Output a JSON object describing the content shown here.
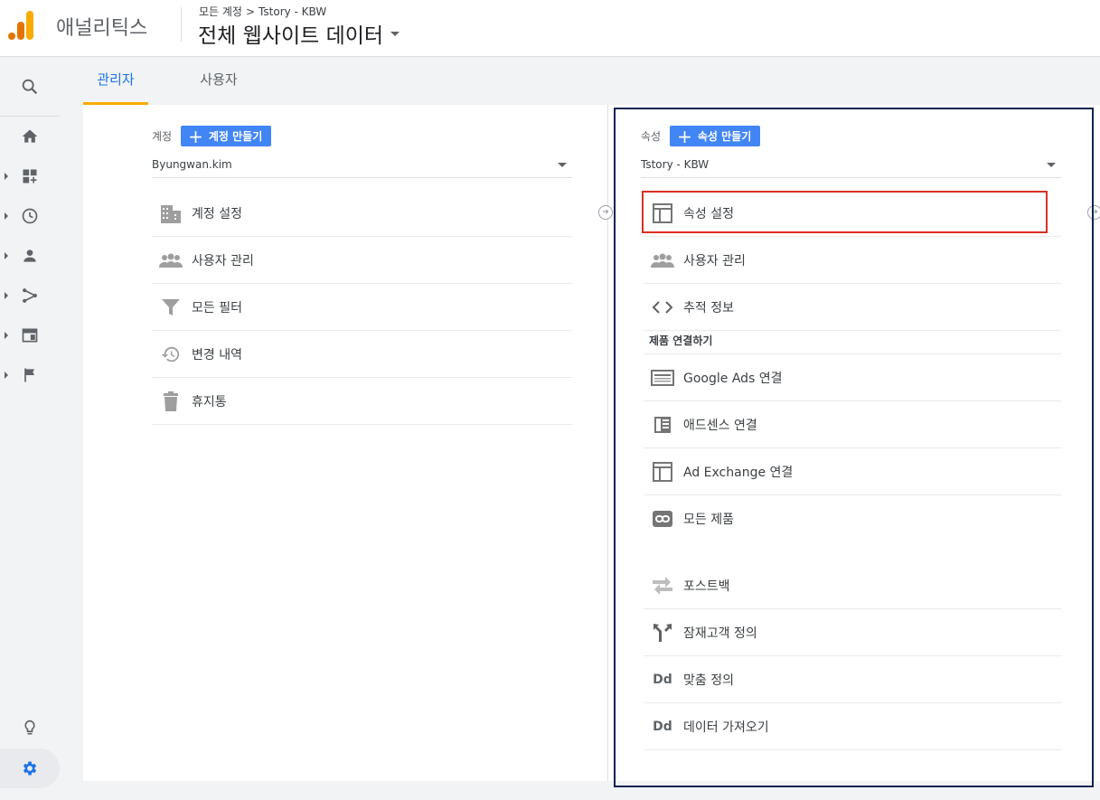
{
  "header": {
    "app_name": "애널리틱스",
    "breadcrumb": [
      "모든 계정",
      "Tstory - KBW"
    ],
    "breadcrumb_separator": ">",
    "view_title": "전체 웹사이트 데이터"
  },
  "tabs": [
    {
      "label": "관리자",
      "active": true
    },
    {
      "label": "사용자",
      "active": false
    }
  ],
  "account_column": {
    "label": "계정",
    "create_button": "계정 만들기",
    "selected": "Byungwan.kim",
    "items": [
      {
        "label": "계정 설정",
        "icon": "building-icon"
      },
      {
        "label": "사용자 관리",
        "icon": "people-icon"
      },
      {
        "label": "모든 필터",
        "icon": "filter-icon"
      },
      {
        "label": "변경 내역",
        "icon": "history-icon"
      },
      {
        "label": "휴지통",
        "icon": "trash-icon"
      }
    ]
  },
  "property_column": {
    "label": "속성",
    "create_button": "속성 만들기",
    "selected": "Tstory - KBW",
    "items": [
      {
        "label": "속성 설정",
        "icon": "layout-icon",
        "highlighted": true
      },
      {
        "label": "사용자 관리",
        "icon": "people-icon"
      },
      {
        "label": "추적 정보",
        "icon": "code-icon"
      }
    ],
    "section_title": "제품 연결하기",
    "product_links": [
      {
        "label": "Google Ads 연결",
        "icon": "ads-icon"
      },
      {
        "label": "애드센스 연결",
        "icon": "adsense-icon"
      },
      {
        "label": "Ad Exchange 연결",
        "icon": "adx-icon"
      },
      {
        "label": "모든 제품",
        "icon": "link-icon"
      }
    ],
    "other_items": [
      {
        "label": "포스트백",
        "icon": "postback-icon"
      },
      {
        "label": "잠재고객 정의",
        "icon": "audience-icon"
      },
      {
        "label": "맞춤 정의",
        "icon": "dd-icon",
        "glyph": "Dd"
      },
      {
        "label": "데이터 가져오기",
        "icon": "dd-icon",
        "glyph": "Dd"
      }
    ]
  },
  "left_nav": [
    "search-icon",
    "home-icon",
    "customization-icon",
    "realtime-icon",
    "audience-icon",
    "acquisition-icon",
    "behavior-icon",
    "conversions-icon",
    "discover-icon",
    "admin-gear-icon"
  ],
  "colors": {
    "accent": "#1a73e8",
    "tab_underline": "#f9ab00",
    "create_button": "#4285f4",
    "highlight_border": "#d93025",
    "frame_border": "#0d2352"
  }
}
